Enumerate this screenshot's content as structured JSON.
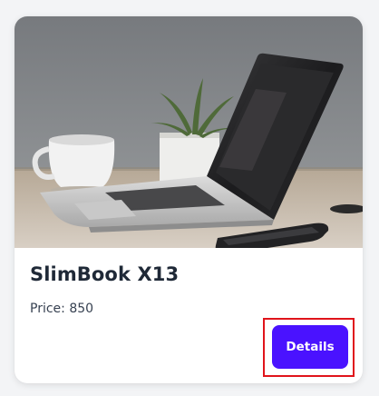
{
  "product": {
    "name": "SlimBook X13",
    "price_text": "Price: 850",
    "image_alt": "laptop-photo"
  },
  "actions": {
    "details_label": "Details"
  },
  "colors": {
    "button_bg": "#4a12ff",
    "highlight_border": "#e0141b",
    "title_text": "#1f2937"
  }
}
